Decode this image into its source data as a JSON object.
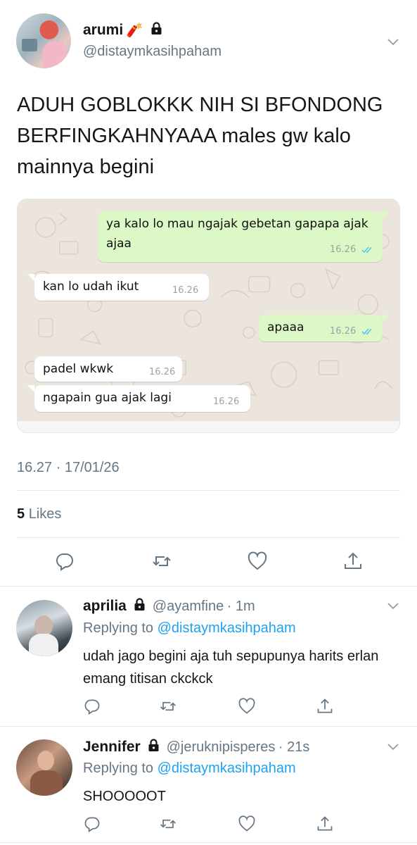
{
  "tweet": {
    "author_name": "arumi",
    "author_emoji": "🧨",
    "author_handle": "@distaymkasihpaham",
    "text": "ADUH GOBLOKKK NIH SI BFONDONG BERFINGKAHNYAAA males gw kalo mainnya begini",
    "timestamp": "16.27 · 17/01/26",
    "likes_count": "5",
    "likes_label": "Likes"
  },
  "chat": {
    "messages": [
      {
        "direction": "out",
        "text": "ya kalo lo mau ngajak gebetan gapapa ajak ajaa",
        "time": "16.26",
        "read": true
      },
      {
        "direction": "in",
        "text": "kan lo udah ikut",
        "time": "16.26"
      },
      {
        "direction": "out",
        "text": "apaaa",
        "time": "16.26",
        "read": true
      },
      {
        "direction": "in",
        "text": "padel wkwk",
        "time": "16.26"
      },
      {
        "direction": "in",
        "text": "ngapain gua ajak lagi",
        "time": "16.26"
      }
    ],
    "colors": {
      "background": "#ece5dd",
      "outgoing": "#dcf8c6",
      "incoming": "#ffffff",
      "ticks": "#4fc3f7"
    }
  },
  "replies": [
    {
      "name": "aprilia",
      "handle": "@ayamfine",
      "age": "· 1m",
      "replying_label": "Replying to",
      "replying_to": "@distaymkasihpaham",
      "text": "udah jago begini aja tuh sepupunya harits erlan emang titisan ckckck"
    },
    {
      "name": "Jennifer",
      "handle": "@jeruknipisperes",
      "age": "· 21s",
      "replying_label": "Replying to",
      "replying_to": "@distaymkasihpaham",
      "text": "SHOOOOOT"
    }
  ],
  "icons": {
    "actions": [
      "reply-icon",
      "retweet-icon",
      "like-icon",
      "share-icon"
    ],
    "lock": "lock-icon",
    "more": "chevron-down-icon"
  },
  "colors": {
    "text": "#14171a",
    "secondary": "#657786",
    "link": "#1da1f2",
    "divider": "#e1e8ed"
  }
}
